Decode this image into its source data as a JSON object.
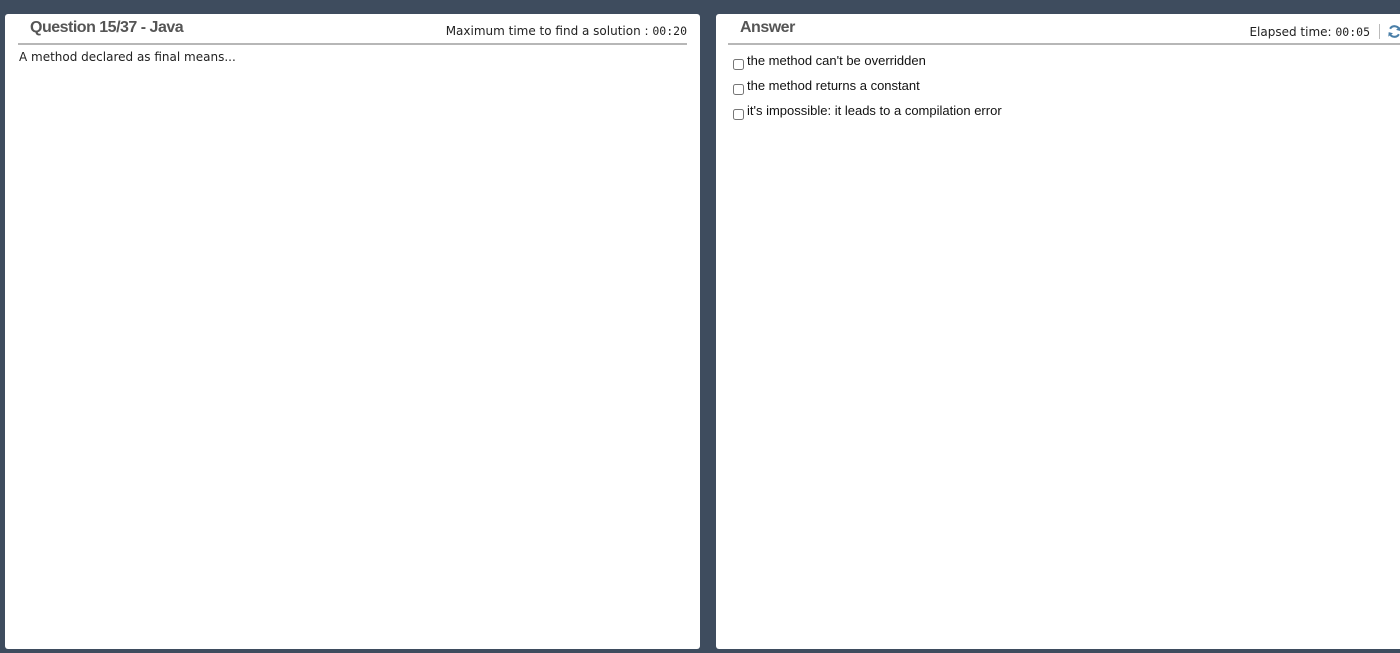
{
  "question": {
    "title": "Question 15/37 - Java",
    "max_time_label": "Maximum time to find a solution : ",
    "max_time_value": "00:20",
    "text": "A method declared as final means..."
  },
  "answer": {
    "title": "Answer",
    "elapsed_label": "Elapsed time: ",
    "elapsed_value": "00:05",
    "refresh_icon": "refresh-icon",
    "options": [
      {
        "label": "the method can't be overridden",
        "checked": false
      },
      {
        "label": "the method returns a constant",
        "checked": false
      },
      {
        "label": "it's impossible: it leads to a compilation error",
        "checked": false
      }
    ]
  },
  "colors": {
    "background": "#3e4c5e",
    "panel": "#ffffff",
    "title_text": "#555555",
    "refresh_icon": "#4a7fa8"
  }
}
